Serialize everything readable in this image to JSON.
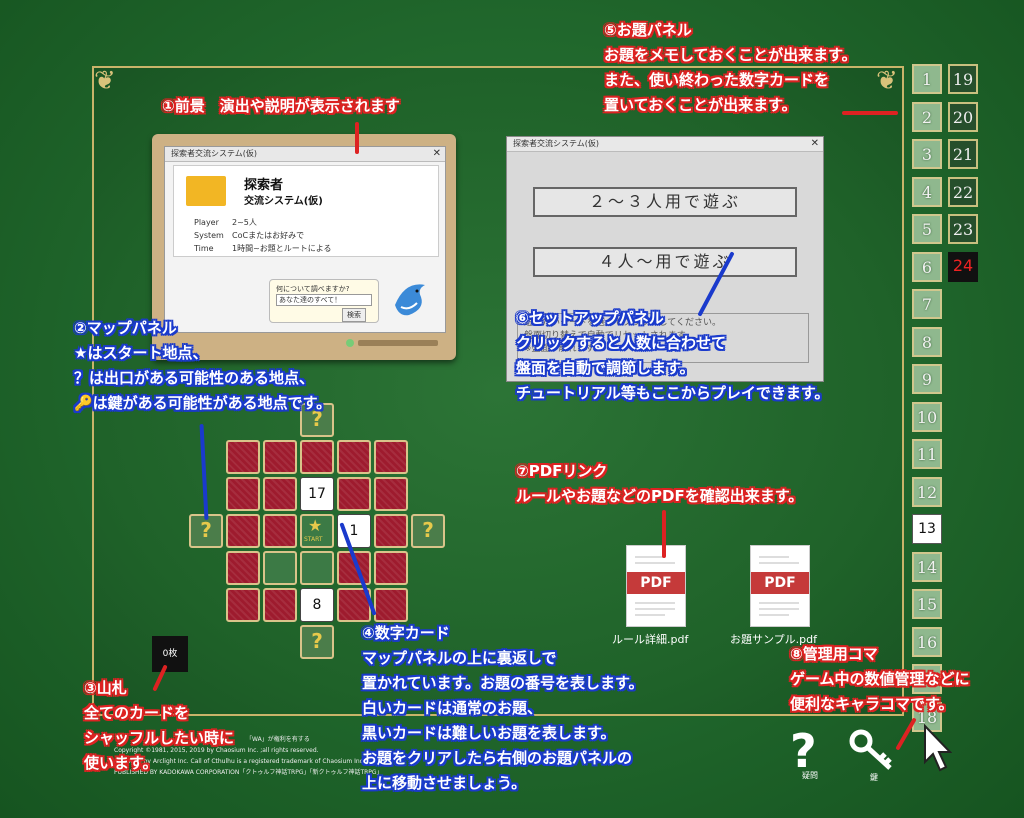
{
  "annotations": {
    "foreground": {
      "title": "①前景　演出や説明が表示されます"
    },
    "map": {
      "title": "②マップパネル",
      "lines": [
        "★はスタート地点、",
        "？は出口がある可能性のある地点、",
        "🔑は鍵がある可能性がある地点です。"
      ]
    },
    "deck": {
      "title": "③山札",
      "lines": [
        "全てのカードを",
        "シャッフルしたい時に",
        "使います。"
      ]
    },
    "number_card": {
      "title": "④数字カード",
      "lines": [
        "マップパネルの上に裏返しで",
        "置かれています。お題の番号を表します。",
        "白いカードは通常のお題、",
        "黒いカードは難しいお題を表します。",
        "お題をクリアしたら右側のお題パネルの",
        "上に移動させましょう。"
      ]
    },
    "theme_panel": {
      "title": "⑤お題パネル",
      "lines": [
        "お題をメモしておくことが出来ます。",
        "また、使い終わった数字カードを",
        "置いておくことが出来ます。"
      ]
    },
    "setup": {
      "title": "⑥セットアップパネル",
      "lines": [
        "クリックすると人数に合わせて",
        "盤面を自動で調節します。",
        "チュートリアル等もここからプレイできます。"
      ]
    },
    "pdf": {
      "title": "⑦PDFリンク",
      "lines": [
        "ルールやお題などのPDFを確認出来ます。"
      ]
    },
    "pieces": {
      "title": "⑧管理用コマ",
      "lines": [
        "ゲーム中の数値管理などに",
        "便利なキャラコマです。"
      ]
    }
  },
  "foreground_window": {
    "title": "探索者交流システム(仮)",
    "heading": "探索者",
    "subheading": "交流システム(仮)",
    "rows": [
      {
        "label": "Player",
        "value": "2~5人"
      },
      {
        "label": "System",
        "value": "CoCまたはお好みで"
      },
      {
        "label": "Time",
        "value": "1時間~お題とルートによる"
      }
    ],
    "bubble_question": "何について調べますか?",
    "bubble_answer": "あなた達のすべて！",
    "search_button": "検索"
  },
  "setup_window": {
    "title": "探索者交流システム(仮)",
    "button_2_3": "２～３人用で遊ぶ",
    "button_4": "４人～用で遊ぶ",
    "hint_line1": "遊びたいモードを選んでクリックしてください。",
    "hint_line2": "盤面切り替えで自動でリセットされます。",
    "hint_line3": "※盤面が崩れます。"
  },
  "map_board": {
    "cards": {
      "top": "17",
      "right": "1",
      "bottom": "8"
    },
    "start_label": "START"
  },
  "deck": {
    "label": "0枚"
  },
  "theme_panel": {
    "left": [
      "1",
      "2",
      "3",
      "4",
      "5",
      "6",
      "7",
      "8",
      "9",
      "10",
      "11",
      "12",
      "13",
      "14",
      "15",
      "16",
      "17",
      "18"
    ],
    "right": [
      "19",
      "20",
      "21",
      "22",
      "23",
      "24"
    ],
    "white_card": "13",
    "black_card": "24"
  },
  "pdf_links": [
    {
      "label": "ルール詳細.pdf"
    },
    {
      "label": "お題サンプル.pdf"
    }
  ],
  "pdf_icon_text": "PDF",
  "pieces": {
    "question_label": "疑問",
    "key_label": "鍵"
  },
  "copyright": {
    "line1": "「WA」が権利を有する",
    "line2": "Copyright ©1981, 2015, 2019 by Chaosium Inc. ;all rights reserved.",
    "line3": "Arranged by Arclight Inc. Call of Cthulhu is a registered trademark of Chaosium Inc.",
    "line4": "PUBLISHED BY KADOKAWA CORPORATION「クトゥルフ神話TRPG」「新クトゥルフ神話TRPG」"
  },
  "colors": {
    "felt": "#226a2e",
    "annotation_red": "#d22",
    "annotation_blue": "#1a3acc",
    "card_red": "#9e1b2e",
    "gold": "#d9c48a"
  }
}
